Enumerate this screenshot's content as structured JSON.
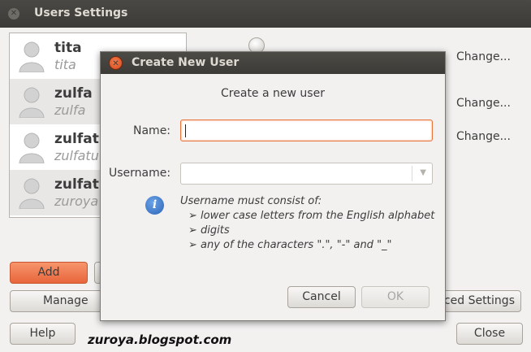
{
  "window": {
    "title": "Users Settings"
  },
  "users": [
    {
      "name": "tita",
      "login": "tita"
    },
    {
      "name": "zulfa",
      "login": "zulfa"
    },
    {
      "name": "zulfatu",
      "login": "zulfatu"
    },
    {
      "name": "zulfatu",
      "login": "zuroya"
    }
  ],
  "change_links": [
    "Change...",
    "Change...",
    "Change..."
  ],
  "buttons": {
    "add": "Add",
    "manage": "Manage",
    "advanced": "nced Settings",
    "help": "Help",
    "close": "Close"
  },
  "watermark": "zuroya.blogspot.com",
  "dialog": {
    "title": "Create New User",
    "heading": "Create a new user",
    "name_label": "Name:",
    "name_value": "",
    "username_label": "Username:",
    "username_value": "",
    "hint_title": "Username must consist of:",
    "hint_items": [
      "➢ lower case letters from the English alphabet",
      "➢ digits",
      "➢ any of the characters \".\", \"-\" and \"_\""
    ],
    "cancel": "Cancel",
    "ok": "OK"
  },
  "colors": {
    "accent": "#e8653c",
    "titlebar": "#3c3b37",
    "info": "#2c64b8"
  }
}
